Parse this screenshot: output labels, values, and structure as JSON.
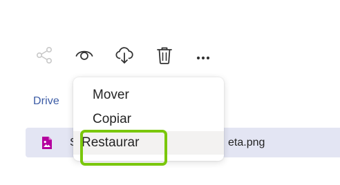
{
  "toolbar": {
    "share_icon": "share-icon",
    "preview_icon": "eye-icon",
    "download_icon": "cloud-download-icon",
    "delete_icon": "trash-icon",
    "more_icon": "more-horizontal-icon"
  },
  "breadcrumb": {
    "root_label": "Drive"
  },
  "file": {
    "name_start": "S",
    "name_end": "eta.png",
    "icon": "image-file-icon",
    "icon_color": "#b4009e",
    "row_color": "#e3e5f3"
  },
  "context_menu": {
    "items": [
      {
        "label": "Mover"
      },
      {
        "label": "Copiar"
      },
      {
        "label": "Restaurar"
      }
    ]
  },
  "colors": {
    "highlight": "#7ac70c",
    "link": "#3b5ba5"
  }
}
